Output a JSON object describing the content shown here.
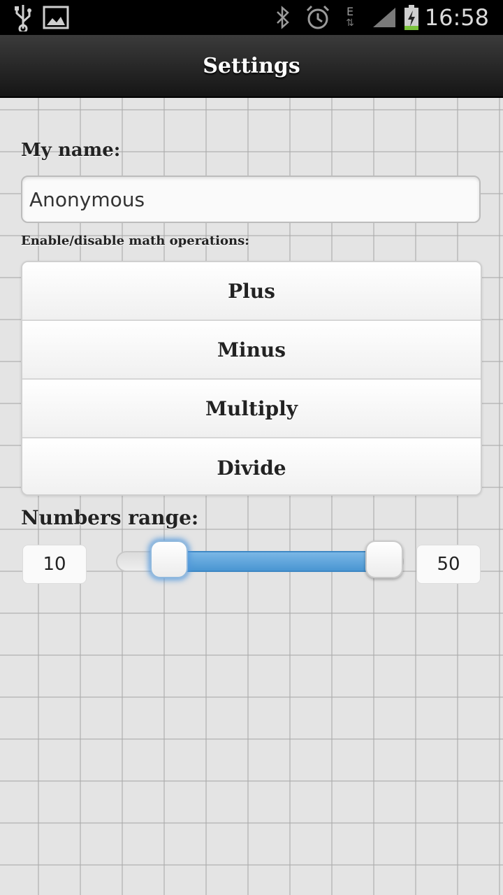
{
  "status_bar": {
    "time": "16:58",
    "icons": [
      "usb-icon",
      "image-icon",
      "bluetooth-icon",
      "alarm-icon",
      "edge-data-icon",
      "signal-icon",
      "battery-charging-icon"
    ],
    "network_letter": "E"
  },
  "header": {
    "title": "Settings"
  },
  "name_section": {
    "label": "My name:",
    "value": "Anonymous"
  },
  "operations": {
    "label": "Enable/disable math operations:",
    "items": [
      {
        "label": "Plus"
      },
      {
        "label": "Minus"
      },
      {
        "label": "Multiply"
      },
      {
        "label": "Divide"
      }
    ]
  },
  "range": {
    "label": "Numbers range:",
    "min_value": "10",
    "max_value": "50",
    "accent": "#4a96d2"
  }
}
